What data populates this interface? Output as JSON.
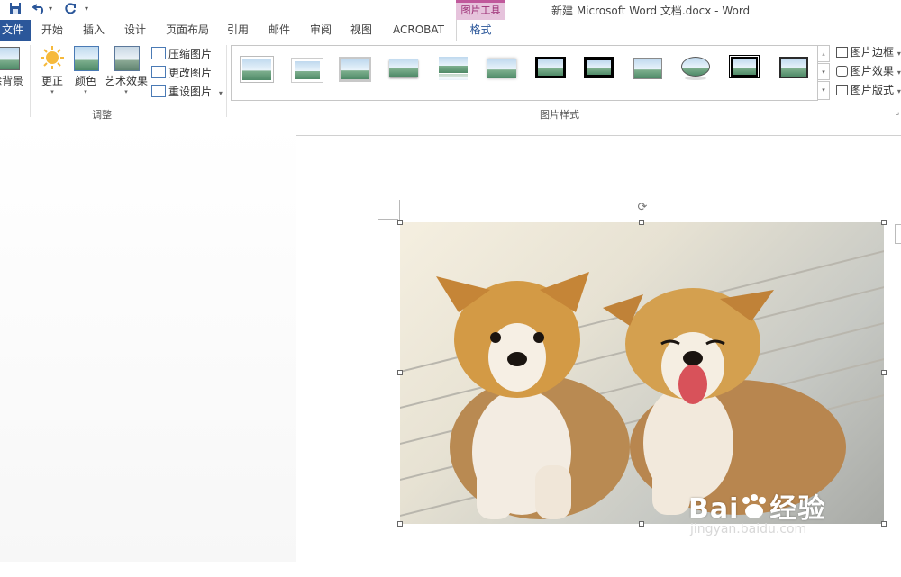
{
  "title_bar": {
    "document_title": "新建 Microsoft Word 文档.docx - Word",
    "contextual_tab_group": "图片工具",
    "quick_access": [
      "save-icon",
      "undo-icon",
      "redo-icon",
      "customize-icon"
    ]
  },
  "tabs": [
    {
      "label": "文件"
    },
    {
      "label": "开始"
    },
    {
      "label": "插入"
    },
    {
      "label": "设计"
    },
    {
      "label": "页面布局"
    },
    {
      "label": "引用"
    },
    {
      "label": "邮件"
    },
    {
      "label": "审阅"
    },
    {
      "label": "视图"
    },
    {
      "label": "ACROBAT"
    },
    {
      "label": "格式",
      "active": true
    }
  ],
  "ribbon": {
    "adjust_group": {
      "label": "调整",
      "remove_background": "除背景",
      "corrections": "更正",
      "color": "颜色",
      "artistic_effects": "艺术效果",
      "compress": "压缩图片",
      "change": "更改图片",
      "reset": "重设图片"
    },
    "picture_styles_group": {
      "label": "图片样式",
      "style_count": 12,
      "picture_border": "图片边框",
      "picture_effects": "图片效果",
      "picture_layout": "图片版式"
    }
  },
  "watermark": {
    "main": "Bai",
    "main_suffix": "经验",
    "sub": "jingyan.baidu.com"
  },
  "colors": {
    "accent": "#2b579a",
    "contextual": "#c0589b"
  }
}
